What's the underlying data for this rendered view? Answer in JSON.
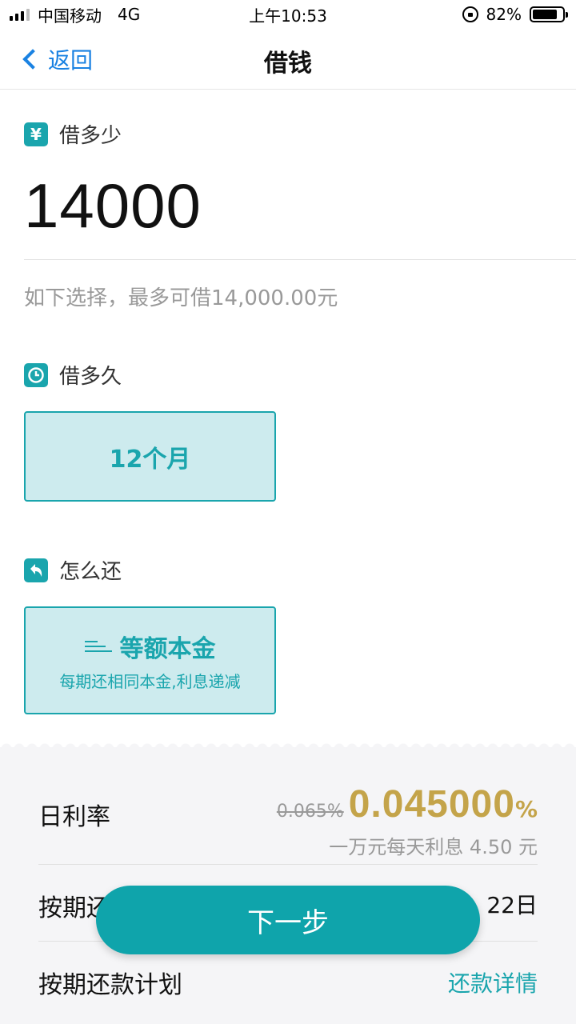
{
  "status_bar": {
    "carrier": "中国移动",
    "network": "4G",
    "time": "上午10:53",
    "battery": "82%",
    "battery_level": 0.82
  },
  "nav": {
    "back_label": "返回",
    "title": "借钱"
  },
  "amount_section": {
    "icon": "yen-icon",
    "icon_glyph": "¥",
    "label": "借多少",
    "amount": "14000",
    "hint": "如下选择，最多可借14,000.00元"
  },
  "term_section": {
    "icon": "clock-icon",
    "label": "借多久",
    "option": "12个月"
  },
  "repay_section": {
    "icon": "return-icon",
    "label": "怎么还",
    "option_title": "等额本金",
    "option_sub": "每期还相同本金,利息递减"
  },
  "panel": {
    "rate_label": "日利率",
    "rate_old": "0.065%",
    "rate_new": "0.045000",
    "rate_pct": "%",
    "rate_sub": "一万元每天利息 4.50 元",
    "schedule_label": "按期还",
    "schedule_value": "22日",
    "plan_label": "按期还款计划",
    "plan_link": "还款详情"
  },
  "colors": {
    "accent": "#1aa5ad",
    "gold": "#c4a44a",
    "link_blue": "#1a82e2"
  },
  "next_button": "下一步"
}
